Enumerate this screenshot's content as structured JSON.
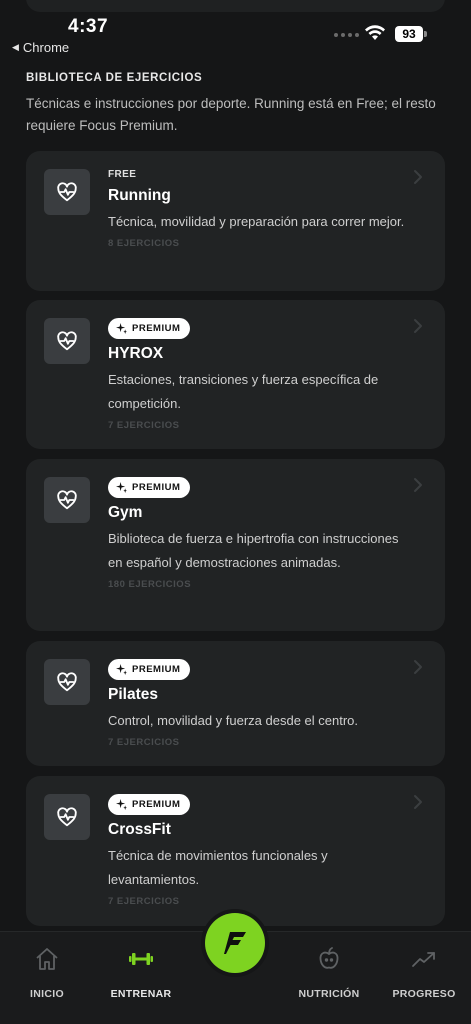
{
  "status_bar": {
    "time": "4:37",
    "back_app": "Chrome",
    "battery": "93"
  },
  "library": {
    "title": "BIBLIOTECA DE EJERCICIOS",
    "description": "Técnicas e instrucciones por deporte. Running está en Free; el resto requiere Focus Premium."
  },
  "sports": [
    {
      "badge": "FREE",
      "name": "Running",
      "description": "Técnica, movilidad y preparación para correr mejor.",
      "count": "8 EJERCICIOS"
    },
    {
      "badge": "PREMIUM",
      "name": "HYROX",
      "description": "Estaciones, transiciones y fuerza específica de competición.",
      "count": "7 EJERCICIOS"
    },
    {
      "badge": "PREMIUM",
      "name": "Gym",
      "description": "Biblioteca de fuerza e hipertrofia con instrucciones en español y demostraciones animadas.",
      "count": "180 EJERCICIOS"
    },
    {
      "badge": "PREMIUM",
      "name": "Pilates",
      "description": "Control, movilidad y fuerza desde el centro.",
      "count": "7 EJERCICIOS"
    },
    {
      "badge": "PREMIUM",
      "name": "CrossFit",
      "description": "Técnica de movimientos funcionales y levantamientos.",
      "count": "7 EJERCICIOS"
    }
  ],
  "nav": {
    "items": [
      {
        "label": "INICIO",
        "icon": "home-icon"
      },
      {
        "label": "ENTRENAR",
        "icon": "dumbbell-icon"
      },
      {
        "label": "NUTRICIÓN",
        "icon": "apple-icon"
      },
      {
        "label": "PROGRESO",
        "icon": "trend-icon"
      }
    ],
    "active": "ENTRENAR",
    "center_icon": "focus-logo-icon"
  },
  "colors": {
    "background": "#151617",
    "card": "#212324",
    "accent": "#7ed321",
    "badge_premium_bg": "#ffffff"
  }
}
